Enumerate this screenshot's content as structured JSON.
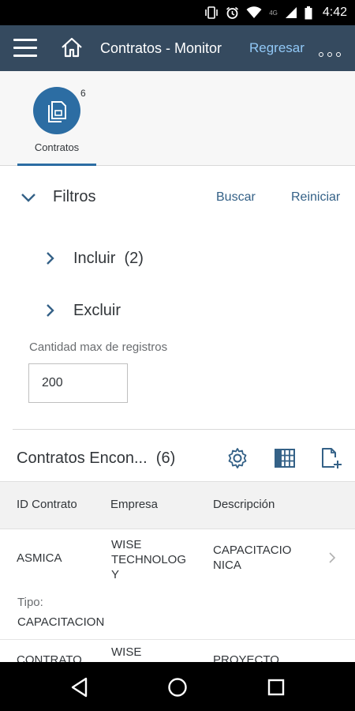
{
  "status_bar": {
    "time": "4:42",
    "network": "4G",
    "icons": [
      "vibrate-icon",
      "alarm-icon",
      "wifi-icon",
      "signal-icon",
      "battery-icon"
    ]
  },
  "shell": {
    "title": "Contratos - Monitor",
    "back_label": "Regresar",
    "colors": {
      "shell_bg": "#354a5f",
      "back_link": "#91c8f6",
      "accent": "#2c6da3"
    }
  },
  "tabs": [
    {
      "label": "Contratos",
      "count": "6",
      "icon": "contract-document-icon",
      "selected": true
    }
  ],
  "filters": {
    "title": "Filtros",
    "search_label": "Buscar",
    "reset_label": "Reiniciar",
    "include_label": "Incluir",
    "include_count": "(2)",
    "exclude_label": "Excluir",
    "max_records_label": "Cantidad max de registros",
    "max_records_value": "200"
  },
  "table": {
    "title": "Contratos Encon...",
    "count": "(6)",
    "toolbar_icons": [
      "settings-icon",
      "table-view-icon",
      "new-document-icon"
    ],
    "columns": [
      "ID Contrato",
      "Empresa",
      "Descripción"
    ],
    "rows": [
      {
        "id": "ASMICA",
        "empresa_lines": [
          "WISE",
          "TECHNOLOG",
          "Y"
        ],
        "descripcion_lines": [
          "CAPACITACIO",
          "NICA"
        ],
        "tipo_label": "Tipo:",
        "tipo_value": "CAPACITACION"
      },
      {
        "id": "CONTRATO",
        "empresa_lines": [
          "WISE"
        ],
        "descripcion_lines": [
          "PROYECTO"
        ]
      }
    ]
  }
}
